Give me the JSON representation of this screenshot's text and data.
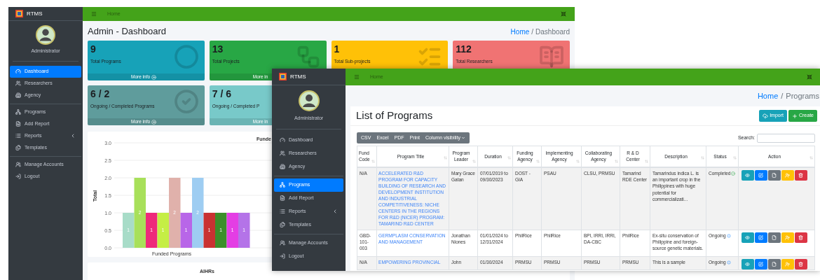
{
  "back_window": {
    "sidebar": {
      "brand": "RTMS",
      "user": "Administrator",
      "nav_groups": [
        [
          {
            "label": "Dashboard",
            "selected": true,
            "has_submenu": false
          },
          {
            "label": "Researchers",
            "selected": false,
            "has_submenu": false
          },
          {
            "label": "Agency",
            "selected": false,
            "has_submenu": false
          }
        ],
        [
          {
            "label": "Programs",
            "selected": false,
            "has_submenu": false
          },
          {
            "label": "Add Report",
            "selected": false,
            "has_submenu": false
          },
          {
            "label": "Reports",
            "selected": false,
            "has_submenu": true
          },
          {
            "label": "Templates",
            "selected": false,
            "has_submenu": false
          }
        ],
        [
          {
            "label": "Manage Accounts",
            "selected": false,
            "has_submenu": false
          },
          {
            "label": "Logout",
            "selected": false,
            "has_submenu": false
          }
        ]
      ]
    },
    "topbar": {
      "link": "Home"
    },
    "page_title": "Admin - Dashboard",
    "breadcrumb": {
      "link": "Home",
      "separator": "/",
      "current": "Dashboard"
    },
    "stat_cards": [
      {
        "value": "9",
        "label": "Total Programs",
        "footer": "More info",
        "footer_icon": true,
        "color": "#17a2b8"
      },
      {
        "value": "13",
        "label": "Total Projects",
        "footer": "More in",
        "footer_icon": false,
        "color": "#28a745"
      },
      {
        "value": "1",
        "label": "Total Sub-projects",
        "color": "#ffc107"
      },
      {
        "value": "112",
        "label": "Total Researchers",
        "color": "#f07373"
      },
      {
        "value": "6 / 2",
        "label": "Ongoing / Completed Programs",
        "footer": "More info",
        "footer_icon": true,
        "color": "#5f9c9c"
      },
      {
        "value": "7 / 6",
        "label": "Ongoing / Completed P",
        "footer": "More in",
        "footer_icon": false,
        "color": "#78c9c9"
      }
    ],
    "chart_card": {
      "chart_data": {
        "type": "bar",
        "title": "Funde",
        "xlabel": "Funded Programs",
        "ylabel": "Total",
        "ylim": [
          0,
          3
        ],
        "yticks": [
          {
            "value": 0,
            "label": "0.0"
          },
          {
            "value": 0.5,
            "label": "0.5"
          },
          {
            "value": 1,
            "label": "1.0"
          },
          {
            "value": 1.5,
            "label": "1.5"
          },
          {
            "value": 2,
            "label": "2.0"
          },
          {
            "value": 2.5,
            "label": "2.5"
          },
          {
            "value": 3,
            "label": "3.0"
          }
        ],
        "values": [
          1,
          2,
          1,
          1,
          2,
          1,
          2,
          1,
          1,
          1,
          1
        ],
        "colors": [
          "#a8dcc8",
          "#a8e05a",
          "#ee2a7b",
          "#c5ee45",
          "#e0b1ab",
          "#b866e8",
          "#9ecdf2",
          "#c93232",
          "#3c8f2a",
          "#e43ee4",
          "#b473e8"
        ],
        "data_labels": true,
        "grid": true
      }
    },
    "bottom_card": {
      "title": "AIHRs"
    }
  },
  "front_window": {
    "sidebar": {
      "brand": "RTMS",
      "user": "Administrator",
      "nav_groups": [
        [
          {
            "label": "Dashboard",
            "selected": false,
            "has_submenu": false
          },
          {
            "label": "Researchers",
            "selected": false,
            "has_submenu": false
          },
          {
            "label": "Agency",
            "selected": false,
            "has_submenu": false
          }
        ],
        [
          {
            "label": "Programs",
            "selected": true,
            "has_submenu": false
          },
          {
            "label": "Add Report",
            "selected": false,
            "has_submenu": false
          },
          {
            "label": "Reports",
            "selected": false,
            "has_submenu": true
          },
          {
            "label": "Templates",
            "selected": false,
            "has_submenu": false
          }
        ],
        [
          {
            "label": "Manage Accounts",
            "selected": false,
            "has_submenu": false
          },
          {
            "label": "Logout",
            "selected": false,
            "has_submenu": false
          }
        ]
      ]
    },
    "topbar": {
      "link": "Home"
    },
    "breadcrumb": {
      "link": "Home",
      "separator": "/",
      "current": "Programs"
    },
    "card": {
      "title": "List of Programs",
      "buttons": [
        {
          "label": "Import",
          "kind": "import"
        },
        {
          "label": "Create",
          "kind": "create"
        }
      ],
      "export_buttons": [
        {
          "label": "CSV",
          "kind": "plain"
        },
        {
          "label": "Excel",
          "kind": "plain"
        },
        {
          "label": "PDF",
          "kind": "plain"
        },
        {
          "label": "Print",
          "kind": "plain"
        },
        {
          "label": "Column visibility",
          "kind": "dropdown"
        }
      ],
      "search": {
        "label": "Search:"
      },
      "table": {
        "columns": [
          "Fund Code",
          "Program Title",
          "Program Leader",
          "Duration",
          "Funding Agency",
          "Implementing Agency",
          "Collaborating Agency",
          "R & D Center",
          "Description",
          "Status",
          "Action"
        ],
        "rows": [
          {
            "fund_code": "N/A",
            "title": "ACCELERATED R&D PROGRAM FOR CAPACITY BUILDING OF RESEARCH AND DEVELOPMENT INSTITUTION AND INDUSTRIAL COMPETITIVENESS: NICHE CENTERS IN THE REGIONS FOR R&D (NICER) PROGRAM: TAMARIND R&D CENTER",
            "leader": "Mary Grace Gatan",
            "duration": "07/01/2019 to 09/30/2023",
            "funding": "DOST - GIA",
            "implementing": "PSAU",
            "collaborating": "CLSU, PRMSU",
            "center": "Tamarind RDE Center",
            "description": "Tamarindus indica L. is an important crop in the Philippines with huge potential for commercializati...",
            "status": "Completed",
            "completed": true
          },
          {
            "fund_code": "GBD-101-003",
            "title": "GERMPLASM CONSERVATION AND MANAGEMENT",
            "leader": "Jonathan Niones",
            "duration": "01/01/2024 to 12/31/2024",
            "funding": "PhilRice",
            "implementing": "PhilRice",
            "collaborating": "BPI, IRRI, IRRI, DA-CBC",
            "center": "PhilRice",
            "description": "Ex-situ conservation of Philippine and foreign-source genetic materials.",
            "status": "Ongoing",
            "completed": false
          },
          {
            "fund_code": "N/A",
            "title": "EMPOWERING PROVINCIAL",
            "leader": "John",
            "duration": "01/30/2024",
            "funding": "PRMSU",
            "implementing": "PRMSU",
            "collaborating": "PRMSU",
            "center": "PRMSU",
            "description": "This is a sample",
            "status": "Ongoing",
            "completed": false
          }
        ]
      }
    }
  }
}
